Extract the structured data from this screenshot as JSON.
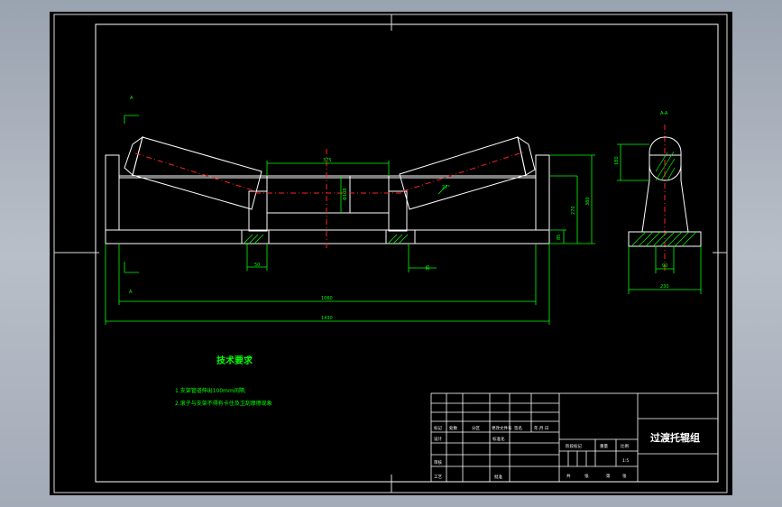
{
  "drawing": {
    "title": "过渡托辊组",
    "tech_req_title": "技术要求",
    "tech_req_items": [
      "1.支架管道伸出100mm间隔;",
      "2.滚子与支架不得有卡住及卫刮摩擦现象"
    ],
    "section_label": "A-A",
    "scale": "1:5",
    "view_marks": [
      "A",
      "A"
    ],
    "dims": {
      "center_width": "375",
      "center_dia": "Φ108",
      "angle": "27°",
      "base_h": "85",
      "height_1": "270",
      "height_2": "380",
      "width_1": "1060",
      "width_2": "1430",
      "left_w": "50",
      "mid_w": "35",
      "sec_top": "180",
      "sec_mid": "90",
      "sec_w": "230",
      "small": "50"
    },
    "title_block": {
      "row1": [
        "标记",
        "处数",
        "分区",
        "更改文件号",
        "签名",
        "年.月.日"
      ],
      "row2": [
        "设计",
        "",
        "标准化",
        ""
      ],
      "row3": [
        "审核",
        "",
        ""
      ],
      "row4": [
        "工艺",
        "",
        "批准",
        ""
      ],
      "right_hdr": [
        "阶段标记",
        "重量",
        "比例"
      ],
      "right_bottom": [
        "共",
        "张",
        "第",
        "张"
      ]
    }
  }
}
